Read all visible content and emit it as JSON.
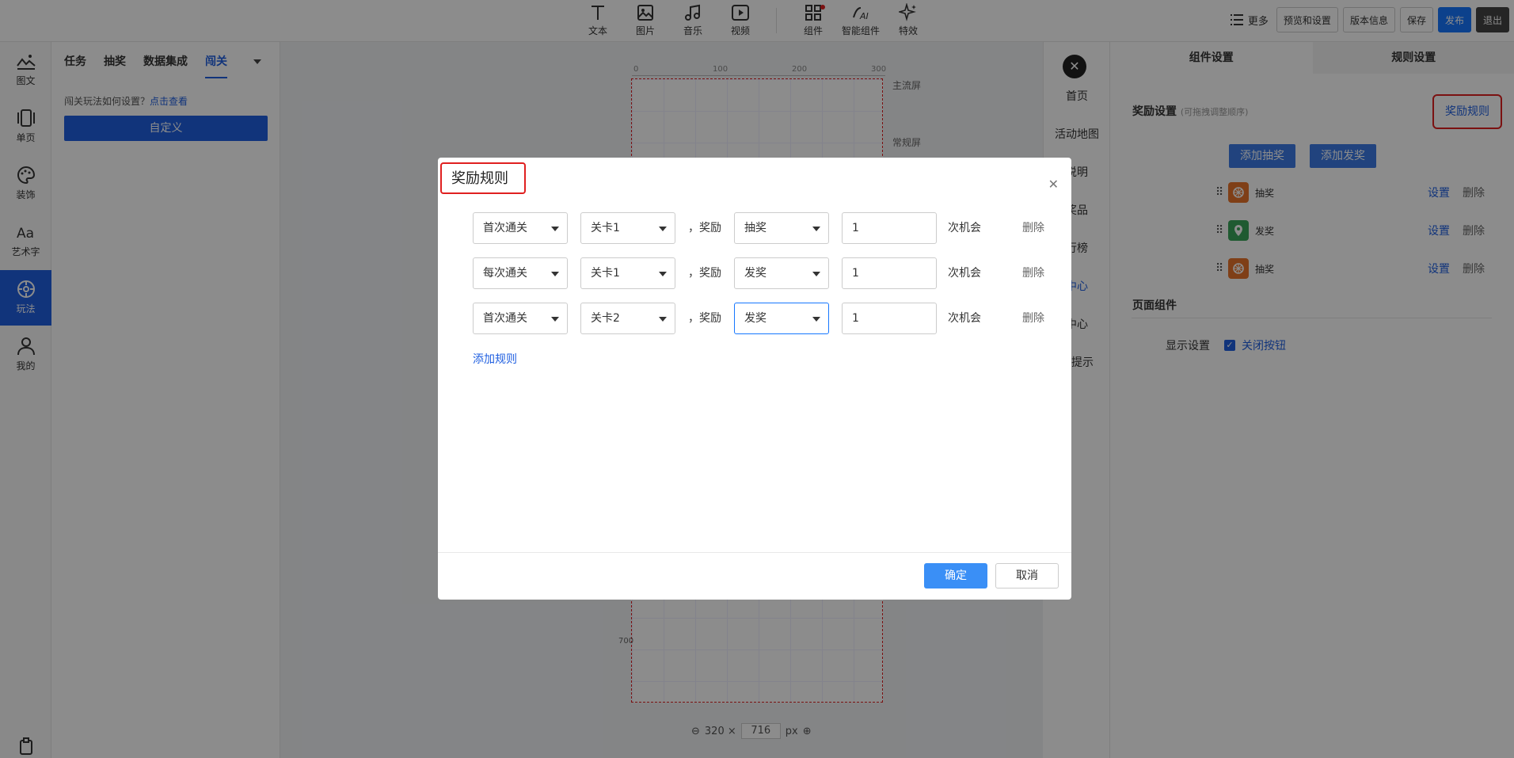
{
  "toolbar": {
    "tools": [
      {
        "label": "文本",
        "icon": "text-icon"
      },
      {
        "label": "图片",
        "icon": "image-icon"
      },
      {
        "label": "音乐",
        "icon": "music-icon"
      },
      {
        "label": "视频",
        "icon": "video-icon"
      },
      {
        "label": "组件",
        "icon": "components-icon"
      },
      {
        "label": "智能组件",
        "icon": "ai-icon"
      },
      {
        "label": "特效",
        "icon": "sparkle-icon"
      }
    ],
    "more": "更多",
    "preview": "预览和设置",
    "version": "版本信息",
    "save": "保存",
    "publish": "发布",
    "exit": "退出"
  },
  "rail": [
    {
      "label": "图文",
      "icon": "image-text-icon"
    },
    {
      "label": "单页",
      "icon": "single-page-icon"
    },
    {
      "label": "装饰",
      "icon": "palette-icon"
    },
    {
      "label": "艺术字",
      "icon": "art-text-icon"
    },
    {
      "label": "玩法",
      "icon": "gameplay-icon",
      "active": true
    },
    {
      "label": "我的",
      "icon": "user-icon"
    }
  ],
  "left_panel": {
    "tabs": [
      "任务",
      "抽奖",
      "数据集成",
      "闯关"
    ],
    "hint_text": "闯关玩法如何设置？",
    "hint_link": "点击查看",
    "custom_button": "自定义"
  },
  "canvas": {
    "ruler_marks": [
      "0",
      "100",
      "200",
      "300"
    ],
    "main_screen": "主流屏",
    "normal_screen": "常规屏",
    "vertical_mark": "700",
    "width_text": "320 ×",
    "height_value": "716",
    "unit": "px"
  },
  "page_list": [
    "首页",
    "活动地图",
    "说明",
    "奖品",
    "行榜",
    "中心",
    "中心",
    "数提示"
  ],
  "right_panel": {
    "tabs": [
      "组件设置",
      "规则设置"
    ],
    "reward_title": "奖励设置",
    "reward_sub": "(可拖拽调整顺序)",
    "reward_rule_link": "奖励规则",
    "add_lottery": "添加抽奖",
    "add_prize": "添加发奖",
    "rewards": [
      {
        "name": "抽奖",
        "color": "#e8742a"
      },
      {
        "name": "发奖",
        "color": "#3aa55a"
      },
      {
        "name": "抽奖",
        "color": "#e8742a"
      }
    ],
    "set_label": "设置",
    "delete_label": "删除",
    "page_components": "页面组件",
    "display_setting": "显示设置",
    "close_button": "关闭按钮"
  },
  "modal": {
    "title": "奖励规则",
    "rules": [
      {
        "condition": "首次通关",
        "level": "关卡1",
        "reward_word": "，奖励",
        "type": "抽奖",
        "count": "1",
        "unit": "次机会",
        "delete": "删除"
      },
      {
        "condition": "每次通关",
        "level": "关卡1",
        "reward_word": "，奖励",
        "type": "发奖",
        "count": "1",
        "unit": "次机会",
        "delete": "删除"
      },
      {
        "condition": "首次通关",
        "level": "关卡2",
        "reward_word": "，奖励",
        "type": "发奖",
        "count": "1",
        "unit": "次机会",
        "delete": "删除"
      }
    ],
    "add_rule": "添加规则",
    "ok": "确定",
    "cancel": "取消"
  }
}
